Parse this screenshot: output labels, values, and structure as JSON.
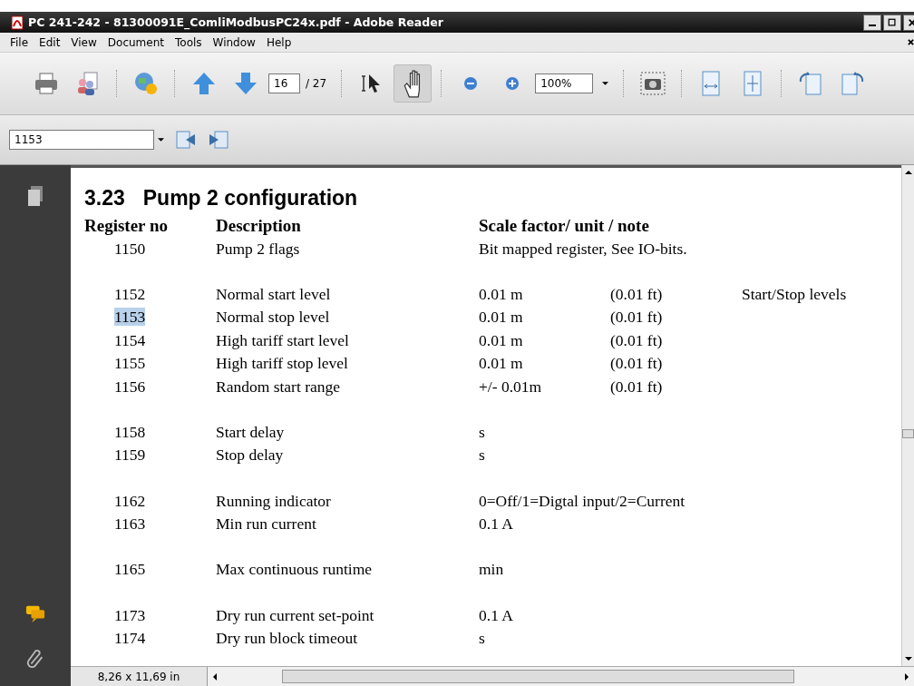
{
  "window": {
    "title": "PC 241-242 - 81300091E_ComliModbusPC24x.pdf - Adobe Reader"
  },
  "menu": [
    "File",
    "Edit",
    "View",
    "Document",
    "Tools",
    "Window",
    "Help"
  ],
  "toolbar": [
    {
      "kind": "print",
      "selected": false
    },
    {
      "kind": "people",
      "selected": false
    },
    {
      "kind": "sep"
    },
    {
      "kind": "globe",
      "selected": false
    },
    {
      "kind": "sep"
    },
    {
      "kind": "up",
      "selected": false
    },
    {
      "kind": "down",
      "selected": false
    },
    {
      "kind": "pagefield"
    },
    {
      "kind": "sep"
    },
    {
      "kind": "select",
      "selected": false
    },
    {
      "kind": "hand",
      "selected": true
    },
    {
      "kind": "sep"
    },
    {
      "kind": "zoomout",
      "selected": false
    },
    {
      "kind": "zoomin",
      "selected": false
    },
    {
      "kind": "zoomfield"
    },
    {
      "kind": "sep"
    },
    {
      "kind": "snapshot",
      "selected": false
    },
    {
      "kind": "sep"
    },
    {
      "kind": "fitwidth",
      "selected": false
    },
    {
      "kind": "fitpage",
      "selected": false
    },
    {
      "kind": "sep"
    },
    {
      "kind": "rotleft",
      "selected": false
    },
    {
      "kind": "rotright",
      "selected": false
    }
  ],
  "page": {
    "current": "16",
    "total": "/ 27"
  },
  "zoom": {
    "value": "100%"
  },
  "search": {
    "value": "1153"
  },
  "document": {
    "heading_number": "3.23",
    "heading": "Pump 2 configuration",
    "columns": [
      "Register no",
      "Description",
      "Scale factor/ unit / note"
    ],
    "groups": [
      [
        {
          "register": "1150",
          "description": "Pump 2 flags",
          "scale": "Bit mapped register, See IO-bits.",
          "highlighted": false
        }
      ],
      [
        {
          "register": "1152",
          "description": "Normal start level",
          "scale": "0.01 m",
          "alt": "(0.01 ft)",
          "note": "Start/Stop levels",
          "highlighted": false
        },
        {
          "register": "1153",
          "description": "Normal stop level",
          "scale": "0.01 m",
          "alt": "(0.01 ft)",
          "highlighted": true
        },
        {
          "register": "1154",
          "description": "High tariff start level",
          "scale": "0.01 m",
          "alt": "(0.01 ft)",
          "highlighted": false
        },
        {
          "register": "1155",
          "description": "High tariff stop level",
          "scale": "0.01 m",
          "alt": "(0.01 ft)",
          "highlighted": false
        },
        {
          "register": "1156",
          "description": "Random start range",
          "scale": "+/- 0.01m",
          "alt": "(0.01 ft)",
          "highlighted": false
        }
      ],
      [
        {
          "register": "1158",
          "description": "Start delay",
          "scale": "s",
          "highlighted": false
        },
        {
          "register": "1159",
          "description": "Stop delay",
          "scale": "s",
          "highlighted": false
        }
      ],
      [
        {
          "register": "1162",
          "description": "Running indicator",
          "scale": "0=Off/1=Digtal input/2=Current",
          "highlighted": false
        },
        {
          "register": "1163",
          "description": "Min run current",
          "scale": "0.1 A",
          "highlighted": false
        }
      ],
      [
        {
          "register": "1165",
          "description": "Max continuous runtime",
          "scale": "min",
          "highlighted": false
        }
      ],
      [
        {
          "register": "1173",
          "description": "Dry run current set-point",
          "scale": "0.1 A",
          "highlighted": false
        },
        {
          "register": "1174",
          "description": "Dry run block timeout",
          "scale": "s",
          "highlighted": false
        }
      ]
    ]
  },
  "status_bar": {
    "page_size": "8,26 x 11,69 in"
  }
}
